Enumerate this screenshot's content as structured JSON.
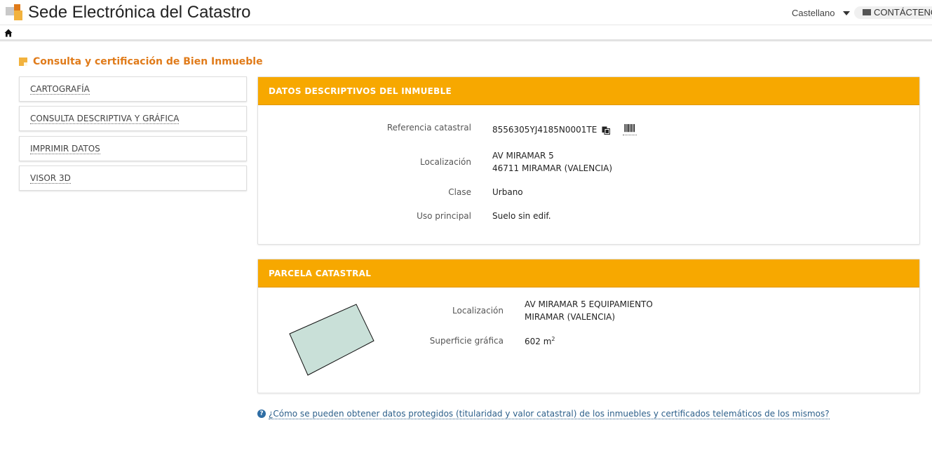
{
  "header": {
    "site_title": "Sede Electrónica del Catastro",
    "language": "Castellano",
    "contact_label": "CONTÁCTENO"
  },
  "page": {
    "heading": "Consulta y certificación de Bien Inmueble"
  },
  "sidebar": {
    "items": [
      {
        "label": "CARTOGRAFÍA"
      },
      {
        "label": "CONSULTA DESCRIPTIVA Y GRÁFICA"
      },
      {
        "label": "IMPRIMIR DATOS"
      },
      {
        "label": "VISOR 3D"
      }
    ]
  },
  "descriptive": {
    "title": "DATOS DESCRIPTIVOS DEL INMUEBLE",
    "ref_label": "Referencia catastral",
    "ref_value": "8556305YJ4185N0001TE",
    "loc_label": "Localización",
    "loc_line1": "AV MIRAMAR 5",
    "loc_line2": "46711 MIRAMAR (VALENCIA)",
    "class_label": "Clase",
    "class_value": "Urbano",
    "use_label": "Uso principal",
    "use_value": "Suelo sin edif."
  },
  "parcel": {
    "title": "PARCELA CATASTRAL",
    "loc_label": "Localización",
    "loc_line1": "AV MIRAMAR 5 EQUIPAMIENTO",
    "loc_line2": "MIRAMAR (VALENCIA)",
    "surface_label": "Superficie gráfica",
    "surface_value": "602 m",
    "surface_unit_sup": "2"
  },
  "help": {
    "link_text": "¿Cómo se pueden obtener datos protegidos (titularidad y valor catastral) de los inmuebles y certificados telemáticos de los mismos?"
  },
  "colors": {
    "accent_orange": "#f7a800",
    "heading_orange": "#e07b1a",
    "parcel_fill": "#c9e0d8"
  }
}
